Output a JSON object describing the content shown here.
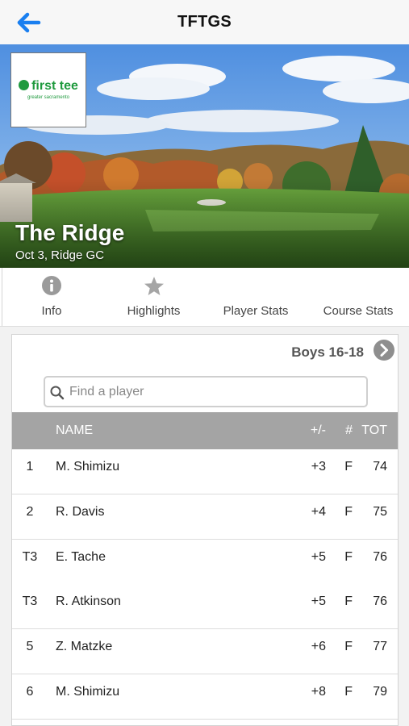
{
  "navbar": {
    "title": "TFTGS"
  },
  "hero": {
    "logo_text": "first tee",
    "logo_subtext": "greater sacramento",
    "event_name": "The Ridge",
    "event_subtitle": "Oct 3, Ridge GC"
  },
  "tabs": [
    {
      "label": "Info",
      "icon": "info-icon"
    },
    {
      "label": "Highlights",
      "icon": "star-icon"
    },
    {
      "label": "Player Stats",
      "icon": ""
    },
    {
      "label": "Course Stats",
      "icon": ""
    }
  ],
  "leaderboard": {
    "division": "Boys 16-18",
    "search_placeholder": "Find a player",
    "columns": {
      "pos": "",
      "name": "NAME",
      "to_par": "+/-",
      "thru": "#",
      "total": "TOT"
    },
    "rows": [
      {
        "pos": "1",
        "name": "M. Shimizu",
        "to_par": "+3",
        "thru": "F",
        "total": "74"
      },
      {
        "pos": "2",
        "name": "R. Davis",
        "to_par": "+4",
        "thru": "F",
        "total": "75"
      },
      {
        "pos": "T3",
        "name": "E. Tache",
        "to_par": "+5",
        "thru": "F",
        "total": "76"
      },
      {
        "pos": "T3",
        "name": "R. Atkinson",
        "to_par": "+5",
        "thru": "F",
        "total": "76"
      },
      {
        "pos": "5",
        "name": "Z. Matzke",
        "to_par": "+6",
        "thru": "F",
        "total": "77"
      },
      {
        "pos": "6",
        "name": "M. Shimizu",
        "to_par": "+8",
        "thru": "F",
        "total": "79"
      }
    ]
  },
  "colors": {
    "accent": "#1a7ff0",
    "brand_green": "#1f9a3e",
    "table_header": "#a4a4a4"
  }
}
